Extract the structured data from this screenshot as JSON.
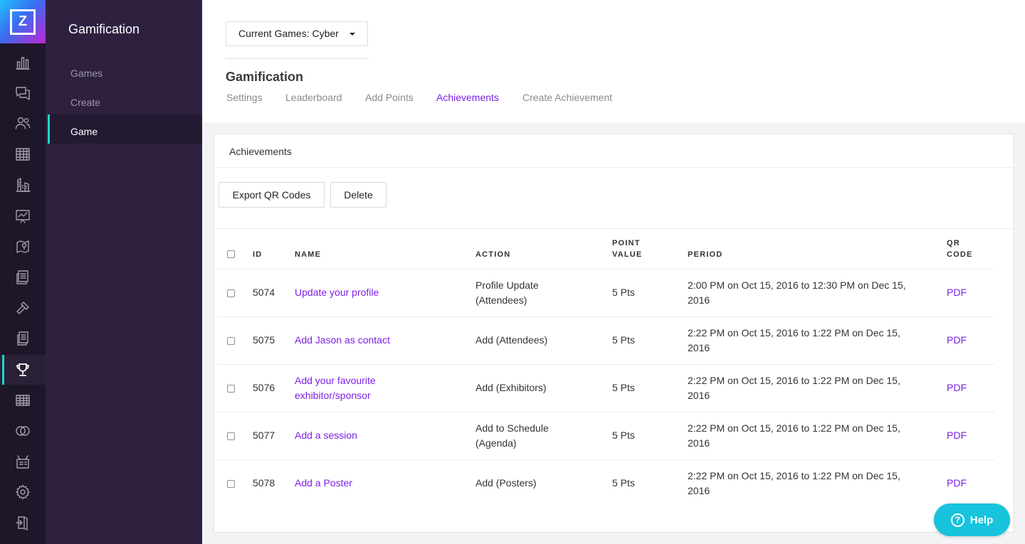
{
  "app": {
    "logo_letter": "Z",
    "accent_color": "#7b1fe6",
    "active_indicator_color": "#22d3c5",
    "help_color": "#17c3dd"
  },
  "rail": {
    "icons": [
      "bar-chart-icon",
      "chat-icon",
      "people-icon",
      "calendar-grid-icon",
      "building-icon",
      "presentation-icon",
      "map-icon",
      "document-icon",
      "gavel-icon",
      "documents-icon",
      "trophy-icon",
      "table-icon",
      "rings-icon",
      "broadcast-icon",
      "gear-icon",
      "logout-icon"
    ],
    "active": "trophy-icon"
  },
  "sidebar": {
    "title": "Gamification",
    "items": [
      {
        "label": "Games",
        "active": false
      },
      {
        "label": "Create",
        "active": false
      },
      {
        "label": "Game",
        "active": true
      }
    ]
  },
  "header": {
    "current_games_label": "Current Games: Cyber",
    "title": "Gamification",
    "tabs": [
      {
        "label": "Settings",
        "active": false
      },
      {
        "label": "Leaderboard",
        "active": false
      },
      {
        "label": "Add Points",
        "active": false
      },
      {
        "label": "Achievements",
        "active": true
      },
      {
        "label": "Create Achievement",
        "active": false
      }
    ]
  },
  "card": {
    "title": "Achievements",
    "buttons": {
      "export": "Export QR Codes",
      "delete": "Delete"
    },
    "columns": {
      "id": "ID",
      "name": "NAME",
      "action": "ACTION",
      "point_value_1": "POINT",
      "point_value_2": "VALUE",
      "period": "PERIOD",
      "qr_1": "QR",
      "qr_2": "CODE"
    },
    "rows": [
      {
        "id": "5074",
        "name_1": "Update your profile",
        "name_2": "",
        "action_1": "Profile Update",
        "action_2": "(Attendees)",
        "points": "5 Pts",
        "period_1": "2:00 PM on Oct 15, 2016 to 12:30 PM on Dec 15,",
        "period_2": "2016",
        "qr": "PDF"
      },
      {
        "id": "5075",
        "name_1": "Add Jason as contact",
        "name_2": "",
        "action_1": "Add (Attendees)",
        "action_2": "",
        "points": "5 Pts",
        "period_1": "2:22 PM on Oct 15, 2016 to 1:22 PM on Dec 15,",
        "period_2": "2016",
        "qr": "PDF"
      },
      {
        "id": "5076",
        "name_1": "Add your favourite",
        "name_2": "exhibitor/sponsor",
        "action_1": "Add (Exhibitors)",
        "action_2": "",
        "points": "5 Pts",
        "period_1": "2:22 PM on Oct 15, 2016 to 1:22 PM on Dec 15,",
        "period_2": "2016",
        "qr": "PDF"
      },
      {
        "id": "5077",
        "name_1": "Add a session",
        "name_2": "",
        "action_1": "Add to Schedule",
        "action_2": "(Agenda)",
        "points": "5 Pts",
        "period_1": "2:22 PM on Oct 15, 2016 to 1:22 PM on Dec 15,",
        "period_2": "2016",
        "qr": "PDF"
      },
      {
        "id": "5078",
        "name_1": "Add a Poster",
        "name_2": "",
        "action_1": "Add (Posters)",
        "action_2": "",
        "points": "5 Pts",
        "period_1": "2:22 PM on Oct 15, 2016 to 1:22 PM on Dec 15,",
        "period_2": "2016",
        "qr": "PDF"
      }
    ]
  },
  "help": {
    "label": "Help",
    "icon_glyph": "?"
  }
}
